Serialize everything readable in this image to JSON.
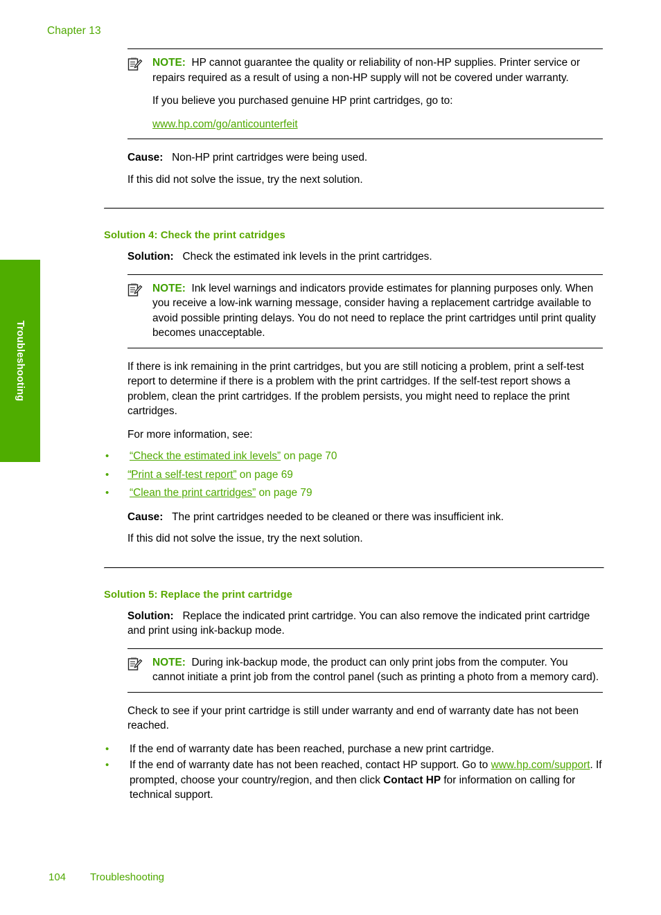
{
  "page": {
    "chapter": "Chapter 13",
    "side_tab": "Troubleshooting",
    "footer_page_number": "104",
    "footer_section": "Troubleshooting",
    "accent_green": "#4fa800",
    "tab_green": "#4fad00",
    "note_label_green": "#3fa000"
  },
  "note1": {
    "label": "NOTE:",
    "paragraph1": "HP cannot guarantee the quality or reliability of non-HP supplies. Printer service or repairs required as a result of using a non-HP supply will not be covered under warranty.",
    "paragraph2": "If you believe you purchased genuine HP print cartridges, go to:",
    "link": "www.hp.com/go/anticounterfeit",
    "icon": "note-pencil-icon"
  },
  "cause1": {
    "label": "Cause:",
    "text": "Non-HP print cartridges were being used.",
    "followup": "If this did not solve the issue, try the next solution."
  },
  "solution4": {
    "heading": "Solution 4: Check the print catridges",
    "solution_label": "Solution:",
    "solution_text": "Check the estimated ink levels in the print cartridges.",
    "note": {
      "label": "NOTE:",
      "text": "Ink level warnings and indicators provide estimates for planning purposes only. When you receive a low-ink warning message, consider having a replacement cartridge available to avoid possible printing delays. You do not need to replace the print cartridges until print quality becomes unacceptable.",
      "icon": "note-pencil-icon"
    },
    "body": "If there is ink remaining in the print cartridges, but you are still noticing a problem, print a self-test report to determine if there is a problem with the print cartridges. If the self-test report shows a problem, clean the print cartridges. If the problem persists, you might need to replace the print cartridges.",
    "more_info_lead": "For more information, see:",
    "links": [
      {
        "title": "“Check the estimated ink levels”",
        "suffix": " on page 70"
      },
      {
        "title": "“Print a self-test report”",
        "suffix": " on page 69"
      },
      {
        "title": "“Clean the print cartridges”",
        "suffix": " on page 79"
      }
    ],
    "cause_label": "Cause:",
    "cause_text": "The print cartridges needed to be cleaned or there was insufficient ink.",
    "followup": "If this did not solve the issue, try the next solution."
  },
  "solution5": {
    "heading": "Solution 5: Replace the print cartridge",
    "solution_label": "Solution:",
    "solution_text": "Replace the indicated print cartridge. You can also remove the indicated print cartridge and print using ink-backup mode.",
    "note": {
      "label": "NOTE:",
      "text": "During ink-backup mode, the product can only print jobs from the computer. You cannot initiate a print job from the control panel (such as printing a photo from a memory card).",
      "icon": "note-pencil-icon"
    },
    "warranty_intro": "Check to see if your print cartridge is still under warranty and end of warranty date has not been reached.",
    "bullet1": "If the end of warranty date has been reached, purchase a new print cartridge.",
    "bullet2_part1": "If the end of warranty date has not been reached, contact HP support. Go to ",
    "bullet2_link": "www.hp.com/support",
    "bullet2_part2": ". If prompted, choose your country/region, and then click ",
    "bullet2_bold": "Contact HP",
    "bullet2_part3": " for information on calling for technical support."
  }
}
